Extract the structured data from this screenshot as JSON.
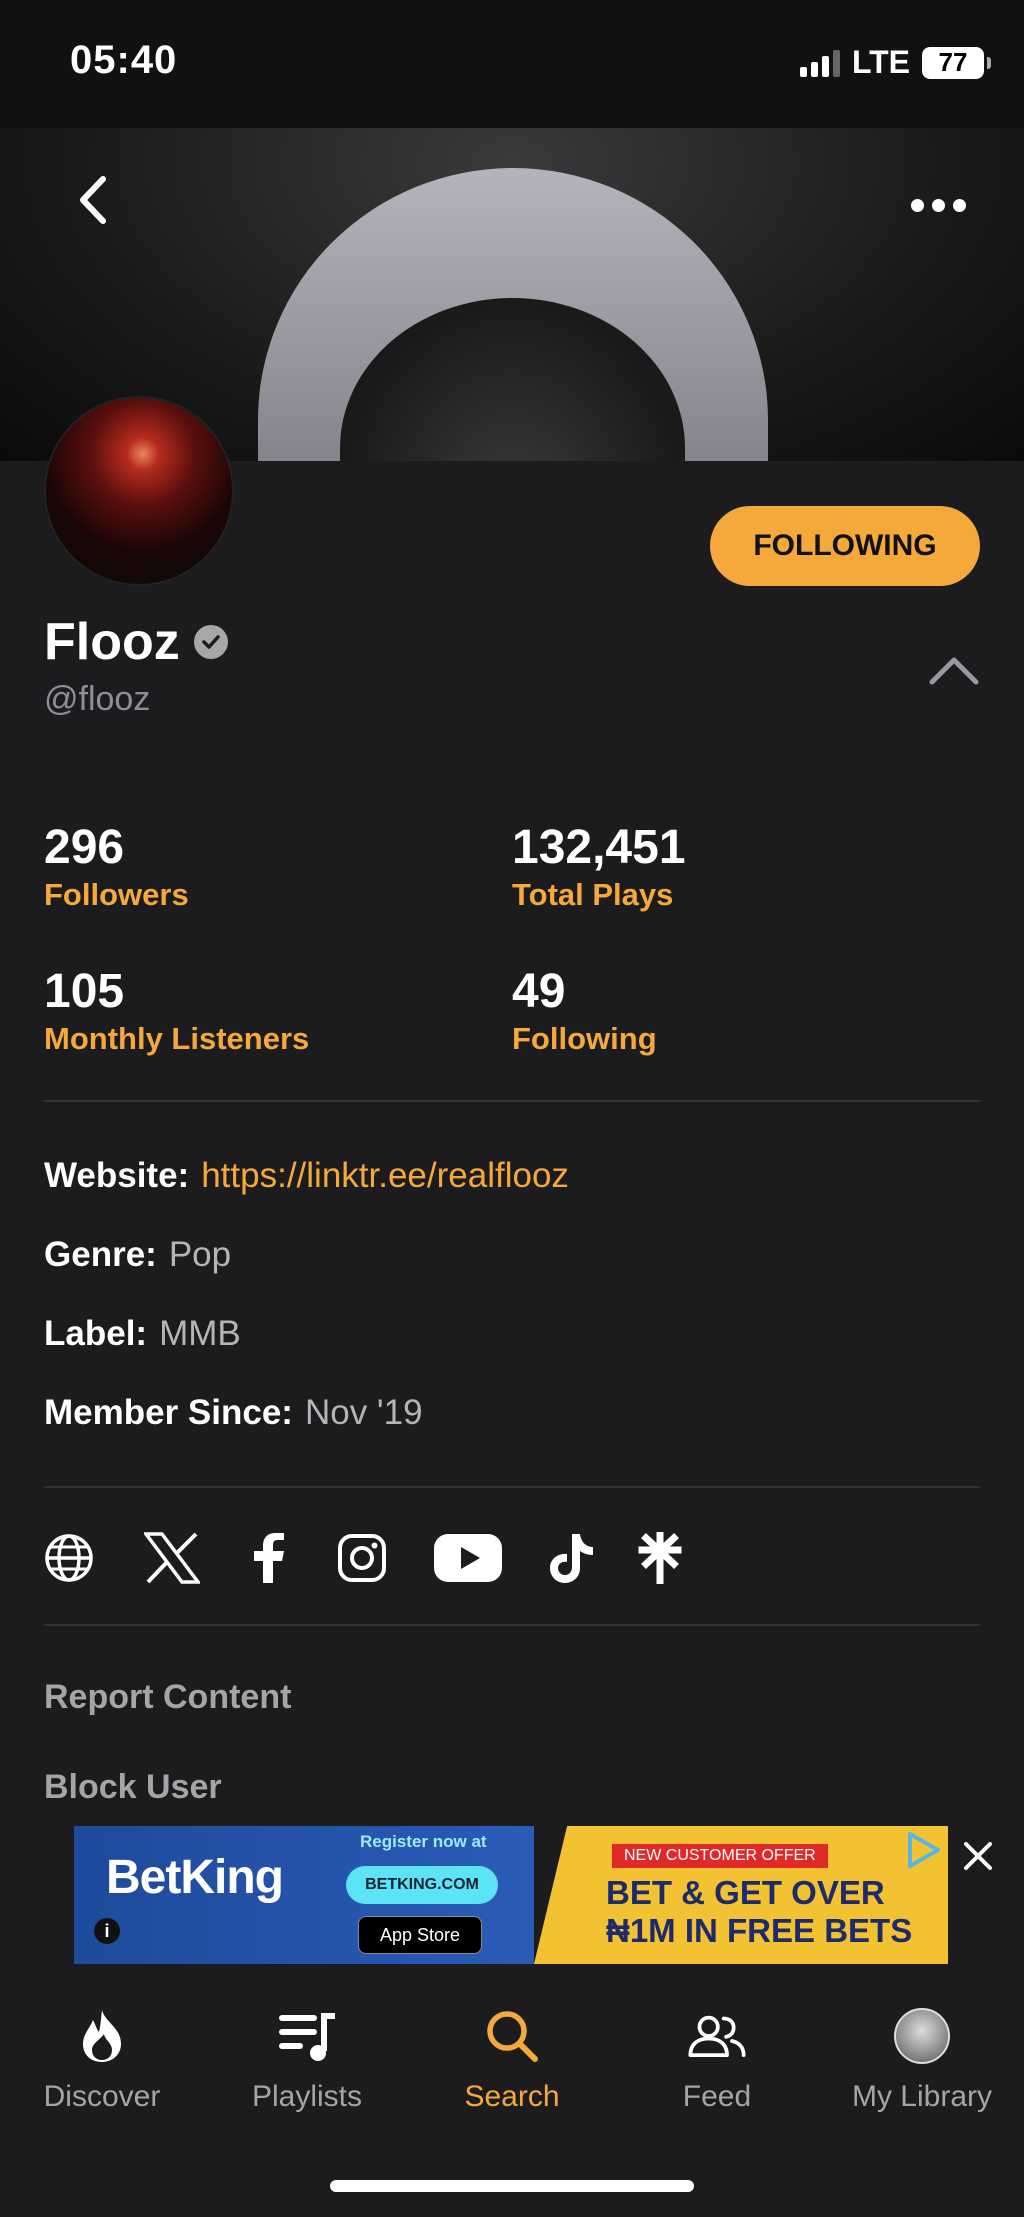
{
  "status_bar": {
    "time": "05:40",
    "network": "LTE",
    "battery": "77"
  },
  "profile": {
    "name": "Flooz",
    "handle": "@flooz",
    "follow_label": "FOLLOWING"
  },
  "stats": [
    {
      "value": "296",
      "label": "Followers"
    },
    {
      "value": "132,451",
      "label": "Total Plays"
    },
    {
      "value": "105",
      "label": "Monthly Listeners"
    },
    {
      "value": "49",
      "label": "Following"
    }
  ],
  "info": {
    "website_label": "Website:",
    "website_value": "https://linktr.ee/realflooz",
    "genre_label": "Genre:",
    "genre_value": "Pop",
    "label_label": "Label:",
    "label_value": "MMB",
    "member_label": "Member Since:",
    "member_value": "Nov '19"
  },
  "socials": [
    "globe-icon",
    "x-icon",
    "facebook-icon",
    "instagram-icon",
    "youtube-icon",
    "tiktok-icon",
    "linktree-icon"
  ],
  "actions": {
    "report": "Report Content",
    "block": "Block User"
  },
  "ad": {
    "brand": "BetKing",
    "register": "Register now at",
    "site": "BETKING.COM",
    "store": "App Store",
    "offer": "NEW CUSTOMER OFFER",
    "headline_1": "BET & GET OVER",
    "headline_2": "₦1M IN FREE BETS"
  },
  "tabs": [
    {
      "label": "Discover",
      "icon": "flame-icon"
    },
    {
      "label": "Playlists",
      "icon": "playlist-icon"
    },
    {
      "label": "Search",
      "icon": "search-icon"
    },
    {
      "label": "Feed",
      "icon": "people-icon"
    },
    {
      "label": "My Library",
      "icon": "avatar-icon"
    }
  ],
  "colors": {
    "accent": "#f4a93a",
    "background": "#1c1c1e",
    "muted": "#a5a5a8"
  }
}
